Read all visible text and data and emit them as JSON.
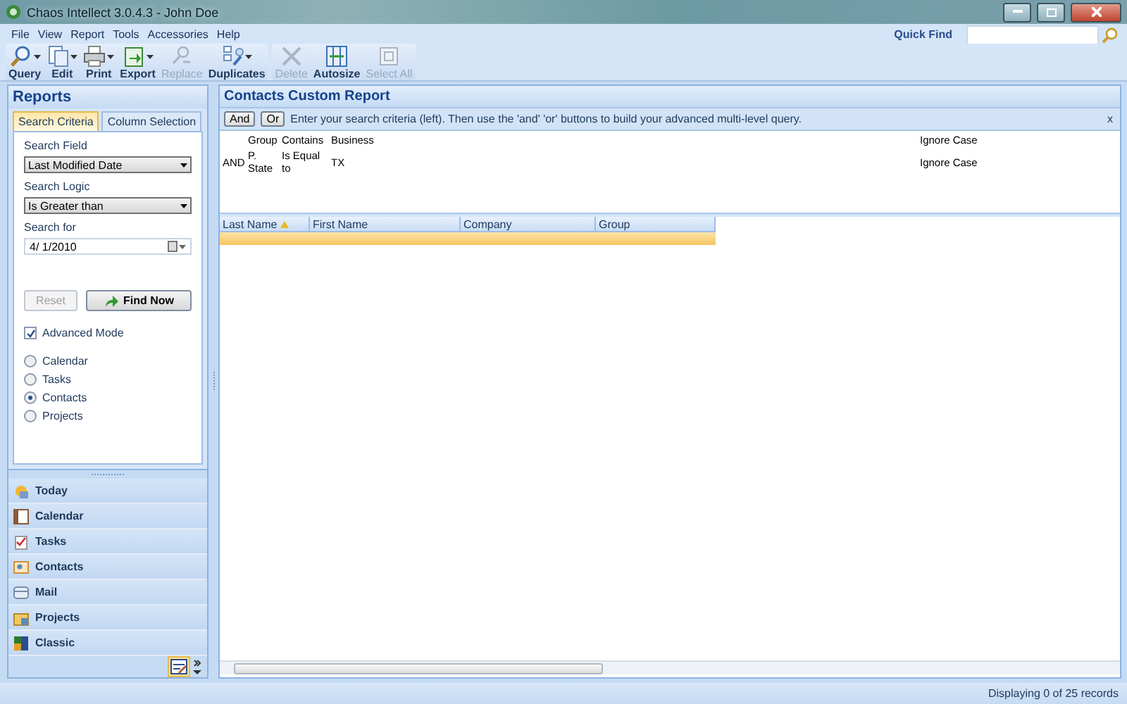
{
  "window": {
    "title": "Chaos Intellect 3.0.4.3 - John Doe"
  },
  "menu": [
    "File",
    "View",
    "Report",
    "Tools",
    "Accessories",
    "Help"
  ],
  "quick_find": {
    "label": "Quick Find"
  },
  "toolbar": [
    {
      "label": "Query",
      "dropdown": true,
      "disabled": false
    },
    {
      "label": "Edit",
      "dropdown": true,
      "disabled": false
    },
    {
      "label": "Print",
      "dropdown": true,
      "disabled": false
    },
    {
      "label": "Export",
      "dropdown": true,
      "disabled": false
    },
    {
      "label": "Replace",
      "dropdown": false,
      "disabled": true
    },
    {
      "label": "Duplicates",
      "dropdown": true,
      "disabled": false
    },
    {
      "label": "Delete",
      "dropdown": false,
      "disabled": true
    },
    {
      "label": "Autosize",
      "dropdown": false,
      "disabled": false
    },
    {
      "label": "Select All",
      "dropdown": false,
      "disabled": true
    }
  ],
  "reports": {
    "title": "Reports",
    "tabs": [
      {
        "label": "Search Criteria",
        "selected": true
      },
      {
        "label": "Column Selection",
        "selected": false
      }
    ],
    "search_field": {
      "label": "Search Field",
      "value": "Last Modified Date"
    },
    "search_logic": {
      "label": "Search Logic",
      "value": "Is Greater than"
    },
    "search_for": {
      "label": "Search for",
      "value": "4/ 1/2010"
    },
    "buttons": [
      {
        "label": "Reset",
        "disabled": true
      },
      {
        "label": "Find Now",
        "disabled": false
      }
    ],
    "advanced_mode": {
      "label": "Advanced Mode",
      "checked": true
    },
    "record_types": [
      {
        "label": "Calendar",
        "selected": false
      },
      {
        "label": "Tasks",
        "selected": false
      },
      {
        "label": "Contacts",
        "selected": true
      },
      {
        "label": "Projects",
        "selected": false
      }
    ]
  },
  "navigation": [
    "Today",
    "Calendar",
    "Tasks",
    "Contacts",
    "Mail",
    "Projects",
    "Classic"
  ],
  "report": {
    "title": "Contacts Custom Report",
    "buttons": [
      "And",
      "Or"
    ],
    "hint": "Enter your search criteria (left). Then use the 'and' 'or' buttons to build your advanced multi-level query.",
    "close": "x",
    "criteria": [
      {
        "field": "Group",
        "logic": "Contains",
        "value": "Business",
        "case": "Ignore Case"
      },
      {
        "operator": "AND",
        "field": "P. State",
        "logic": "Is Equal to",
        "value": "TX",
        "case": "Ignore Case"
      }
    ],
    "table": {
      "columns": [
        {
          "label": "Last Name",
          "sorted": true
        },
        {
          "label": "First Name",
          "sorted": false
        },
        {
          "label": "Company",
          "sorted": false
        },
        {
          "label": "Group",
          "sorted": false
        }
      ]
    }
  },
  "status_bar": "Displaying 0 of 25 records"
}
